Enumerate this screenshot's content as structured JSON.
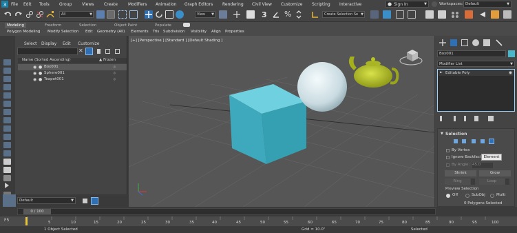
{
  "colors": {
    "accent_blue": "#2f6fb3",
    "selection_blue": "#3c76b5",
    "box_cyan": "#4ab7c9",
    "teapot_yellow": "#b8c61e",
    "sphere_white": "#e9f1f4",
    "timeline_yellow": "#e8c63a"
  },
  "menu": [
    "File",
    "Edit",
    "Tools",
    "Group",
    "Views",
    "Create",
    "Modifiers",
    "Animation",
    "Graph Editors",
    "Rendering",
    "Civil View",
    "Customize",
    "Scripting",
    "Interactive"
  ],
  "sign_in": "Sign In",
  "workspaces": {
    "label": "Workspaces:",
    "value": "Default"
  },
  "toolbar": {
    "filter_select": "All",
    "view_select": "View",
    "number_badge": "3",
    "create_selection": "Create Selection Se"
  },
  "ribbon": {
    "tabs": [
      "Modeling",
      "Freeform",
      "Selection",
      "Object Paint",
      "Populate"
    ],
    "sub": [
      "Polygon Modeling",
      "Modify Selection",
      "Edit",
      "Geometry (All)",
      "Elements",
      "Tris",
      "Subdivision",
      "Visibility",
      "Align",
      "Properties"
    ]
  },
  "explorer": {
    "menu": [
      "Select",
      "Display",
      "Edit",
      "Customize"
    ],
    "column_name": "Name (Sorted Ascending)",
    "column_frozen": "▲ Frozen",
    "objects": [
      "Box001",
      "Sphere001",
      "Teapot001"
    ]
  },
  "viewport": {
    "label": "[+] [Perspective ] [Standard ] [Default Shading ]"
  },
  "command_panel": {
    "object_name": "Box001",
    "modifier_list": "Modifier List",
    "stack_item": "Editable Poly",
    "selection_title": "Selection",
    "by_vertex": "By Vertex",
    "ignore_backfacing": "Ignore Backfacin",
    "by_angle": "By Angle:",
    "by_angle_value": "45.0",
    "shrink": "Shrink",
    "grow": "Grow",
    "ring": "Ring",
    "loop": "Loop",
    "preview_title": "Preview Selection",
    "preview_options": [
      "Off",
      "SubObj",
      "Multi"
    ],
    "status": "0 Polygons Selected",
    "tooltip": "Element"
  },
  "layers": {
    "value": "Default"
  },
  "time": {
    "slider": "0 / 100",
    "ticks": [
      "5",
      "10",
      "15",
      "20",
      "25",
      "30",
      "35",
      "40",
      "45",
      "50",
      "55",
      "60",
      "65",
      "70",
      "75",
      "80",
      "85",
      "90",
      "95",
      "100"
    ],
    "objects_selected": "1 Object Selected",
    "grid_value": "Grid = 10.0\"",
    "selected_label": "Selected"
  }
}
